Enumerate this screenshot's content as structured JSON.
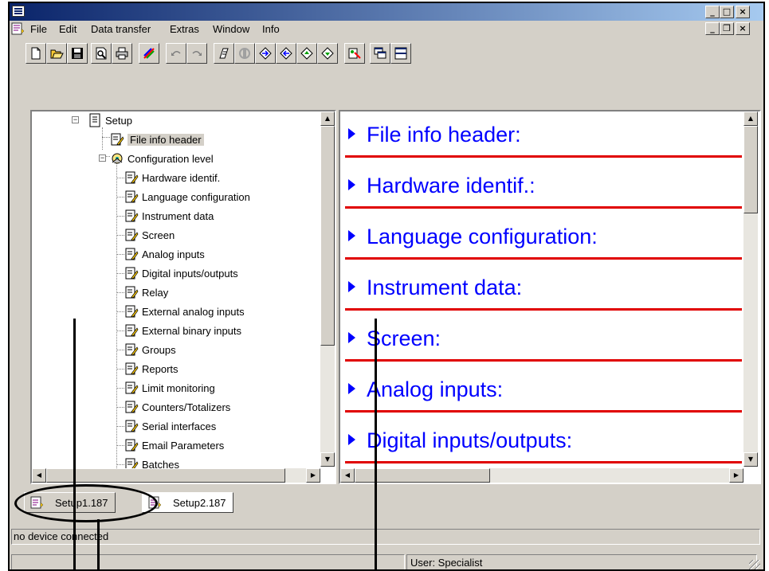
{
  "window": {
    "controls": {
      "minimize": "_",
      "maximize": "□",
      "close": "×"
    },
    "child_controls": {
      "minimize": "_",
      "restore": "❐",
      "close": "×"
    }
  },
  "menu": [
    "File",
    "Edit",
    "Data transfer",
    "Extras",
    "Window",
    "Info"
  ],
  "toolbar": {
    "icons": [
      "new-icon",
      "open-icon",
      "save-icon",
      "print-preview-icon",
      "print-icon",
      "color-icon",
      "undo-icon",
      "redo-icon",
      "transfer-icon",
      "disabled-transfer-icon",
      "read-icon",
      "write-icon",
      "upload-icon",
      "download-icon",
      "extras-icon",
      "cascade-icon",
      "tile-icon"
    ]
  },
  "tree": {
    "root": "Setup",
    "file_info": "File info header",
    "config_level": "Configuration level",
    "items": [
      "Hardware identif.",
      "Language configuration",
      "Instrument data",
      "Screen",
      "Analog inputs",
      "Digital inputs/outputs",
      "Relay",
      "External analog inputs",
      "External binary inputs",
      "Groups",
      "Reports",
      "Limit monitoring",
      "Counters/Totalizers",
      "Serial interfaces",
      "Email Parameters",
      "Batches"
    ]
  },
  "content": {
    "sections": [
      "File info header:",
      "Hardware identif.:",
      "Language configuration:",
      "Instrument data:",
      "Screen:",
      "Analog inputs:",
      "Digital inputs/outputs:"
    ]
  },
  "tabs": [
    "Setup1.187",
    "Setup2.187"
  ],
  "status": {
    "connection": "no device connected",
    "user": "User: Specialist"
  },
  "colors": {
    "accent_blue": "#0000ff",
    "rule_red": "#e00000",
    "titlebar": "#0a246a"
  }
}
